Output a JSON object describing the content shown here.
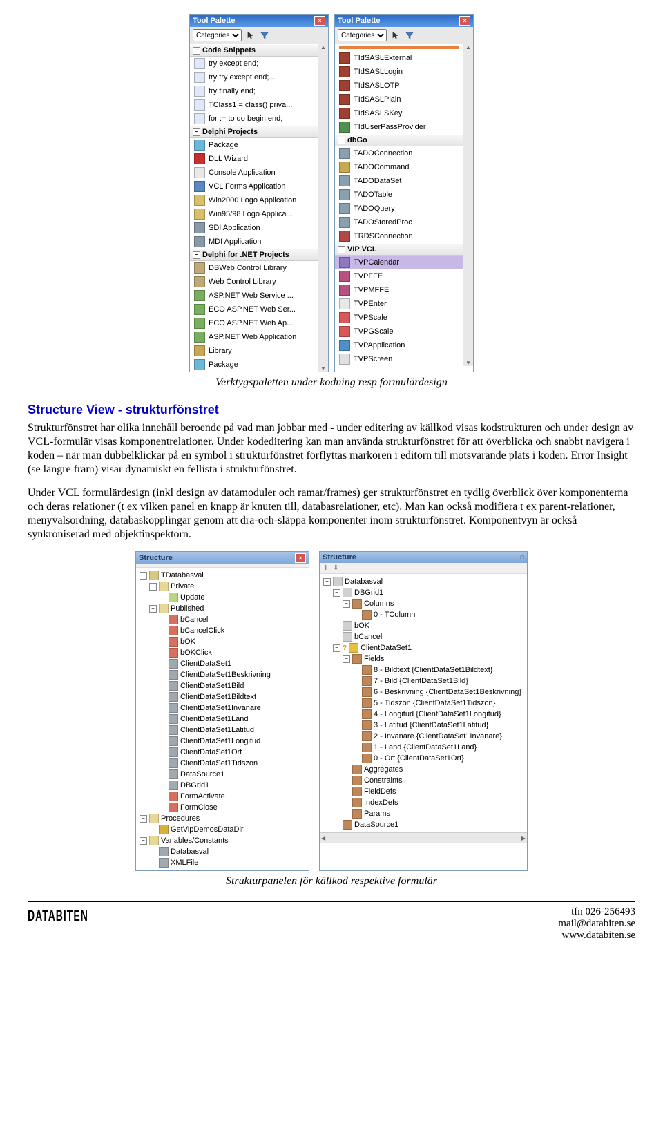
{
  "palettes": {
    "title": "Tool Palette",
    "categories_label": "Categories",
    "left": {
      "groups": [
        {
          "name": "Code Snippets",
          "items": [
            {
              "label": "try except end;",
              "c": "#dfe9f7"
            },
            {
              "label": "try  try  except  end;...",
              "c": "#dfe9f7"
            },
            {
              "label": "try finally end;",
              "c": "#dfe9f7"
            },
            {
              "label": "TClass1 = class() priva...",
              "c": "#dfe9f7"
            },
            {
              "label": "for := to do begin end;",
              "c": "#dfe9f7"
            }
          ]
        },
        {
          "name": "Delphi Projects",
          "items": [
            {
              "label": "Package",
              "c": "#6bb8d8"
            },
            {
              "label": "DLL Wizard",
              "c": "#c83030"
            },
            {
              "label": "Console Application",
              "c": "#e8e8e8"
            },
            {
              "label": "VCL Forms Application",
              "c": "#5a88c0"
            },
            {
              "label": "Win2000 Logo Application",
              "c": "#d8c068"
            },
            {
              "label": "Win95/98 Logo Applica...",
              "c": "#d8c068"
            },
            {
              "label": "SDI Application",
              "c": "#8899aa"
            },
            {
              "label": "MDI Application",
              "c": "#8899aa"
            }
          ]
        },
        {
          "name": "Delphi for .NET Projects",
          "items": [
            {
              "label": "DBWeb Control Library",
              "c": "#c0a878"
            },
            {
              "label": "Web Control Library",
              "c": "#c0a878"
            },
            {
              "label": "ASP.NET Web Service ...",
              "c": "#78b060"
            },
            {
              "label": "ECO ASP.NET Web Ser...",
              "c": "#78b060"
            },
            {
              "label": "ECO ASP.NET Web Ap...",
              "c": "#78b060"
            },
            {
              "label": "ASP.NET Web Application",
              "c": "#78b060"
            },
            {
              "label": "Library",
              "c": "#c8a850"
            },
            {
              "label": "Package",
              "c": "#6bb8d8"
            }
          ]
        }
      ]
    },
    "right": {
      "groups": [
        {
          "name": "",
          "hide_header": true,
          "items": [
            {
              "label": "TIdSASLExternal",
              "c": "#a04030"
            },
            {
              "label": "TIdSASLLogin",
              "c": "#a04030"
            },
            {
              "label": "TIdSASLOTP",
              "c": "#a04030"
            },
            {
              "label": "TIdSASLPlain",
              "c": "#a04030"
            },
            {
              "label": "TIdSASLSKey",
              "c": "#a04030"
            },
            {
              "label": "TIdUserPassProvider",
              "c": "#509050"
            }
          ]
        },
        {
          "name": "dbGo",
          "items": [
            {
              "label": "TADOConnection",
              "c": "#88a0b0"
            },
            {
              "label": "TADOCommand",
              "c": "#c8a850"
            },
            {
              "label": "TADODataSet",
              "c": "#88a0b0"
            },
            {
              "label": "TADOTable",
              "c": "#88a0b0"
            },
            {
              "label": "TADOQuery",
              "c": "#88a0b0"
            },
            {
              "label": "TADOStoredProc",
              "c": "#88a0b0"
            },
            {
              "label": "TRDSConnection",
              "c": "#b04848"
            }
          ]
        },
        {
          "name": "VIP VCL",
          "items": [
            {
              "label": "TVPCalendar",
              "c": "#9078c0",
              "sel": true
            },
            {
              "label": "TVPFFE",
              "c": "#b85080"
            },
            {
              "label": "TVPMFFE",
              "c": "#b85080"
            },
            {
              "label": "TVPEnter",
              "c": "#e8e8e8"
            },
            {
              "label": "TVPScale",
              "c": "#d85858"
            },
            {
              "label": "TVPGScale",
              "c": "#d85858"
            },
            {
              "label": "TVPApplication",
              "c": "#5090c8"
            },
            {
              "label": "TVPScreen",
              "c": "#e0e0e0"
            }
          ]
        }
      ]
    }
  },
  "caption1": "Verktygspaletten under kodning resp formulärdesign",
  "heading": "Structure View - strukturfönstret",
  "para1": "Strukturfönstret har olika innehåll beroende på vad man jobbar med - under editering av källkod visas kodstrukturen och under design av VCL-formulär visas komponentrelationer. Under kodeditering kan man använda strukturfönstret för att överblicka och snabbt navigera i koden – när man dubbelklickar på en symbol i strukturfönstret förflyttas markören i editorn till motsvarande plats i koden. Error Insight (se längre fram) visar dynamiskt en fellista i strukturfönstret.",
  "para2": "Under VCL formulärdesign (inkl design av datamoduler och ramar/frames) ger strukturfönstret en tydlig överblick över komponenterna och deras relationer (t ex vilken panel en knapp är knuten till, databasrelationer, etc). Man kan också modifiera t ex parent-relationer, menyvalsordning, databaskopplingar genom att dra-och-släppa komponenter inom strukturfönstret. Komponentvyn är också synkroniserad med objektinspektorn.",
  "structures": {
    "title": "Structure",
    "left_tree": [
      {
        "d": 0,
        "pm": "-",
        "c": "#d8c880",
        "t": "TDatabasval"
      },
      {
        "d": 1,
        "pm": "-",
        "c": "#e8d898",
        "t": "Private"
      },
      {
        "d": 2,
        "pm": "",
        "c": "#b8d880",
        "t": "Update"
      },
      {
        "d": 1,
        "pm": "-",
        "c": "#e8d898",
        "t": "Published"
      },
      {
        "d": 2,
        "pm": "",
        "c": "#d87060",
        "t": "bCancel"
      },
      {
        "d": 2,
        "pm": "",
        "c": "#d87060",
        "t": "bCancelClick"
      },
      {
        "d": 2,
        "pm": "",
        "c": "#d87060",
        "t": "bOK"
      },
      {
        "d": 2,
        "pm": "",
        "c": "#d87060",
        "t": "bOKClick"
      },
      {
        "d": 2,
        "pm": "",
        "c": "#a0a8b0",
        "t": "ClientDataSet1"
      },
      {
        "d": 2,
        "pm": "",
        "c": "#a0a8b0",
        "t": "ClientDataSet1Beskrivning"
      },
      {
        "d": 2,
        "pm": "",
        "c": "#a0a8b0",
        "t": "ClientDataSet1Bild"
      },
      {
        "d": 2,
        "pm": "",
        "c": "#a0a8b0",
        "t": "ClientDataSet1Bildtext"
      },
      {
        "d": 2,
        "pm": "",
        "c": "#a0a8b0",
        "t": "ClientDataSet1Invanare"
      },
      {
        "d": 2,
        "pm": "",
        "c": "#a0a8b0",
        "t": "ClientDataSet1Land"
      },
      {
        "d": 2,
        "pm": "",
        "c": "#a0a8b0",
        "t": "ClientDataSet1Latitud"
      },
      {
        "d": 2,
        "pm": "",
        "c": "#a0a8b0",
        "t": "ClientDataSet1Longitud"
      },
      {
        "d": 2,
        "pm": "",
        "c": "#a0a8b0",
        "t": "ClientDataSet1Ort"
      },
      {
        "d": 2,
        "pm": "",
        "c": "#a0a8b0",
        "t": "ClientDataSet1Tidszon"
      },
      {
        "d": 2,
        "pm": "",
        "c": "#a0a8b0",
        "t": "DataSource1"
      },
      {
        "d": 2,
        "pm": "",
        "c": "#a0a8b0",
        "t": "DBGrid1"
      },
      {
        "d": 2,
        "pm": "",
        "c": "#d87060",
        "t": "FormActivate"
      },
      {
        "d": 2,
        "pm": "",
        "c": "#d87060",
        "t": "FormClose"
      },
      {
        "d": 0,
        "pm": "-",
        "c": "#e8d898",
        "t": "Procedures"
      },
      {
        "d": 1,
        "pm": "",
        "c": "#d8b040",
        "t": "GetVipDemosDataDir"
      },
      {
        "d": 0,
        "pm": "-",
        "c": "#e8d898",
        "t": "Variables/Constants"
      },
      {
        "d": 1,
        "pm": "",
        "c": "#a0a8b0",
        "t": "Databasval"
      },
      {
        "d": 1,
        "pm": "",
        "c": "#a0a8b0",
        "t": "XMLFile"
      }
    ],
    "right_tree": [
      {
        "d": 0,
        "pm": "-",
        "c": "#d0d0d0",
        "t": "Databasval"
      },
      {
        "d": 1,
        "pm": "-",
        "c": "#d0d0d0",
        "t": "DBGrid1"
      },
      {
        "d": 2,
        "pm": "-",
        "c": "#c08858",
        "t": "Columns"
      },
      {
        "d": 3,
        "pm": "",
        "c": "#c08858",
        "t": "0 - TColumn"
      },
      {
        "d": 1,
        "pm": "",
        "c": "#d0d0d0",
        "t": "bOK"
      },
      {
        "d": 1,
        "pm": "",
        "c": "#d0d0d0",
        "t": "bCancel"
      },
      {
        "d": 1,
        "pm": "-",
        "c": "#e8c040",
        "t": "ClientDataSet1",
        "warn": true
      },
      {
        "d": 2,
        "pm": "-",
        "c": "#c08858",
        "t": "Fields"
      },
      {
        "d": 3,
        "pm": "",
        "c": "#c08858",
        "t": "8 - Bildtext {ClientDataSet1Bildtext}"
      },
      {
        "d": 3,
        "pm": "",
        "c": "#c08858",
        "t": "7 - Bild {ClientDataSet1Bild}"
      },
      {
        "d": 3,
        "pm": "",
        "c": "#c08858",
        "t": "6 - Beskrivning {ClientDataSet1Beskrivning}"
      },
      {
        "d": 3,
        "pm": "",
        "c": "#c08858",
        "t": "5 - Tidszon {ClientDataSet1Tidszon}"
      },
      {
        "d": 3,
        "pm": "",
        "c": "#c08858",
        "t": "4 - Longitud {ClientDataSet1Longitud}"
      },
      {
        "d": 3,
        "pm": "",
        "c": "#c08858",
        "t": "3 - Latitud {ClientDataSet1Latitud}"
      },
      {
        "d": 3,
        "pm": "",
        "c": "#c08858",
        "t": "2 - Invanare {ClientDataSet1Invanare}"
      },
      {
        "d": 3,
        "pm": "",
        "c": "#c08858",
        "t": "1 - Land {ClientDataSet1Land}"
      },
      {
        "d": 3,
        "pm": "",
        "c": "#c08858",
        "t": "0 - Ort {ClientDataSet1Ort}"
      },
      {
        "d": 2,
        "pm": "",
        "c": "#c08858",
        "t": "Aggregates"
      },
      {
        "d": 2,
        "pm": "",
        "c": "#c08858",
        "t": "Constraints"
      },
      {
        "d": 2,
        "pm": "",
        "c": "#c08858",
        "t": "FieldDefs"
      },
      {
        "d": 2,
        "pm": "",
        "c": "#c08858",
        "t": "IndexDefs"
      },
      {
        "d": 2,
        "pm": "",
        "c": "#c08858",
        "t": "Params"
      },
      {
        "d": 1,
        "pm": "",
        "c": "#c08858",
        "t": "DataSource1"
      }
    ]
  },
  "caption2": "Strukturpanelen för källkod respektive formulär",
  "footer": {
    "brand": "DATABITEN",
    "phone": "tfn 026-256493",
    "email": "mail@databiten.se",
    "web": "www.databiten.se"
  }
}
